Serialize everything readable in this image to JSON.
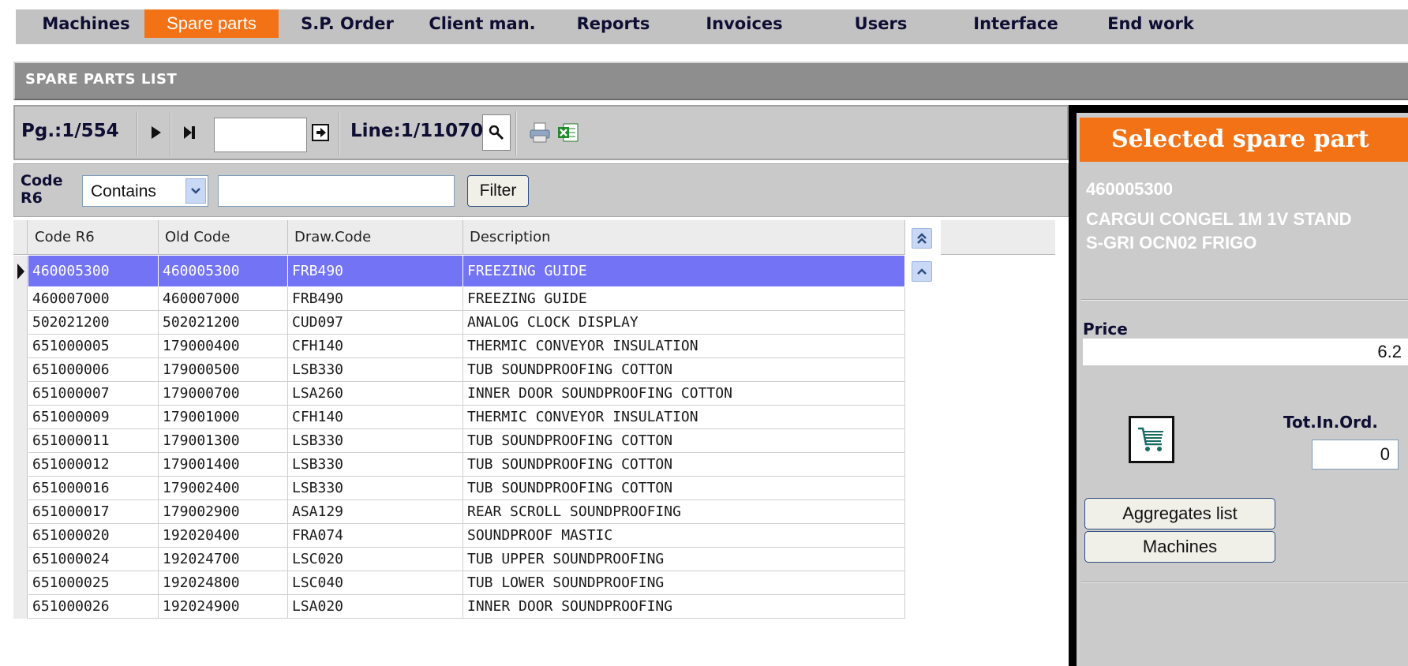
{
  "nav": {
    "items": [
      {
        "label": "Machines",
        "active": false
      },
      {
        "label": "Spare parts",
        "active": true
      },
      {
        "label": "S.P. Order",
        "active": false
      },
      {
        "label": "Client man.",
        "active": false
      },
      {
        "label": "Reports",
        "active": false
      },
      {
        "label": "Invoices",
        "active": false
      },
      {
        "label": "Users",
        "active": false
      },
      {
        "label": "Interface",
        "active": false
      },
      {
        "label": "End work",
        "active": false
      }
    ]
  },
  "page_title": "SPARE PARTS LIST",
  "toolbar": {
    "pager": "Pg.:1/554",
    "page_input_value": "",
    "line": "Line:1/11070",
    "icons": [
      "play-next-icon",
      "last-page-icon",
      "go-to-page-icon",
      "search-icon",
      "print-icon",
      "excel-export-icon"
    ]
  },
  "filter": {
    "label_line1": "Code",
    "label_line2": "R6",
    "mode": "Contains",
    "value": "",
    "button": "Filter"
  },
  "grid": {
    "headers": [
      "Code R6",
      "Old Code",
      "Draw.Code",
      "Description"
    ],
    "rows": [
      [
        "460005300",
        "460005300",
        "FRB490",
        "FREEZING GUIDE"
      ],
      [
        "460007000",
        "460007000",
        "FRB490",
        "FREEZING GUIDE"
      ],
      [
        "502021200",
        "502021200",
        "CUD097",
        "ANALOG CLOCK DISPLAY"
      ],
      [
        "651000005",
        "179000400",
        "CFH140",
        "THERMIC CONVEYOR INSULATION"
      ],
      [
        "651000006",
        "179000500",
        "LSB330",
        "TUB SOUNDPROOFING COTTON"
      ],
      [
        "651000007",
        "179000700",
        "LSA260",
        "INNER DOOR SOUNDPROOFING COTTON"
      ],
      [
        "651000009",
        "179001000",
        "CFH140",
        "THERMIC CONVEYOR INSULATION"
      ],
      [
        "651000011",
        "179001300",
        "LSB330",
        "TUB SOUNDPROOFING COTTON"
      ],
      [
        "651000012",
        "179001400",
        "LSB330",
        "TUB SOUNDPROOFING COTTON"
      ],
      [
        "651000016",
        "179002400",
        "LSB330",
        "TUB SOUNDPROOFING COTTON"
      ],
      [
        "651000017",
        "179002900",
        "ASA129",
        "REAR SCROLL SOUNDPROOFING"
      ],
      [
        "651000020",
        "192020400",
        "FRA074",
        "SOUNDPROOF MASTIC"
      ],
      [
        "651000024",
        "192024700",
        "LSC020",
        "TUB UPPER SOUNDPROOFING"
      ],
      [
        "651000025",
        "192024800",
        "LSC040",
        "TUB LOWER SOUNDPROOFING"
      ],
      [
        "651000026",
        "192024900",
        "LSA020",
        "INNER DOOR SOUNDPROOFING"
      ]
    ],
    "selected_index": 0
  },
  "selected_part": {
    "title": "Selected spare part",
    "code": "460005300",
    "description_line1": "CARGUI CONGEL 1M 1V STAND",
    "description_line2": "S-GRI OCN02 FRIGO",
    "price_label": "Price",
    "price": "6.2",
    "tot_label": "Tot.In.Ord.",
    "tot_value": "0",
    "aggregates_button": "Aggregates list",
    "machines_button": "Machines"
  },
  "colors": {
    "accent": "#f47216",
    "selected_row": "#7373f5",
    "panel_gray": "#cbcbcb"
  }
}
